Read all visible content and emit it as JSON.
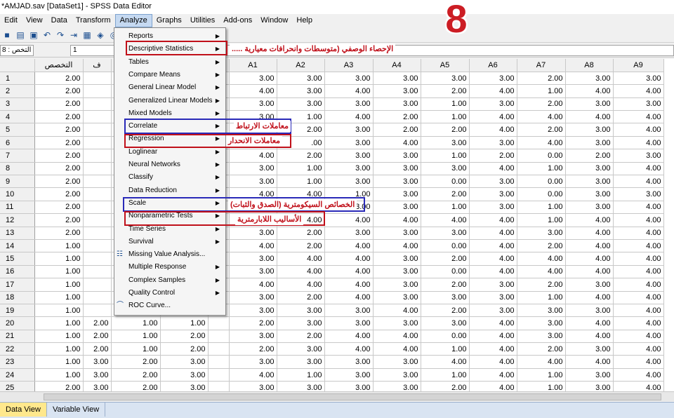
{
  "window": {
    "title": "*AMJAD.sav [DataSet1] - SPSS Data Editor"
  },
  "menubar": [
    "Edit",
    "View",
    "Data",
    "Transform",
    "Analyze",
    "Graphs",
    "Utilities",
    "Add-ons",
    "Window",
    "Help"
  ],
  "toolbar": {
    "icons": [
      "save-icon",
      "print-icon",
      "dialog-recall-icon",
      "undo-icon",
      "redo-icon",
      "goto-case-icon",
      "insert-variable-icon",
      "value-labels-icon",
      "use-sets-icon"
    ]
  },
  "cellbar": {
    "ref": "8 : التخص",
    "value": "1"
  },
  "grid": {
    "headers": [
      "",
      "التخصص",
      "ف",
      "",
      "",
      "",
      "A1",
      "A2",
      "A3",
      "A4",
      "A5",
      "A6",
      "A7",
      "A8",
      "A9"
    ],
    "rows": [
      [
        "1",
        "2.00",
        "",
        "",
        "",
        "",
        "3.00",
        "3.00",
        "3.00",
        "3.00",
        "3.00",
        "3.00",
        "2.00",
        "3.00",
        "3.00"
      ],
      [
        "2",
        "2.00",
        "",
        "",
        "",
        "",
        "4.00",
        "3.00",
        "4.00",
        "3.00",
        "2.00",
        "4.00",
        "1.00",
        "4.00",
        "4.00"
      ],
      [
        "3",
        "2.00",
        "",
        "",
        "",
        "",
        "3.00",
        "3.00",
        "3.00",
        "3.00",
        "1.00",
        "3.00",
        "2.00",
        "3.00",
        "3.00"
      ],
      [
        "4",
        "2.00",
        "",
        "",
        "",
        "",
        "3.00",
        "1.00",
        "4.00",
        "2.00",
        "1.00",
        "4.00",
        "4.00",
        "4.00",
        "4.00"
      ],
      [
        "5",
        "2.00",
        "",
        "",
        "",
        "",
        "3.00",
        "2.00",
        "3.00",
        "2.00",
        "2.00",
        "4.00",
        "2.00",
        "3.00",
        "4.00"
      ],
      [
        "6",
        "2.00",
        "",
        "",
        "",
        "",
        "4.00",
        ".00",
        "3.00",
        "4.00",
        "3.00",
        "3.00",
        "4.00",
        "3.00",
        "4.00"
      ],
      [
        "7",
        "2.00",
        "",
        "",
        "",
        "",
        "4.00",
        "2.00",
        "3.00",
        "3.00",
        "1.00",
        "2.00",
        "0.00",
        "2.00",
        "3.00"
      ],
      [
        "8",
        "2.00",
        "",
        "",
        "",
        "",
        "3.00",
        "1.00",
        "3.00",
        "3.00",
        "3.00",
        "4.00",
        "1.00",
        "3.00",
        "4.00"
      ],
      [
        "9",
        "2.00",
        "",
        "",
        "",
        "",
        "3.00",
        "1.00",
        "3.00",
        "3.00",
        "0.00",
        "3.00",
        "0.00",
        "3.00",
        "4.00"
      ],
      [
        "10",
        "2.00",
        "",
        "",
        "",
        "",
        "4.00",
        "4.00",
        "1.00",
        "3.00",
        "2.00",
        "3.00",
        "0.00",
        "3.00",
        "3.00"
      ],
      [
        "11",
        "2.00",
        "",
        "",
        "",
        "",
        "1.00",
        "1.00",
        "3.00",
        "3.00",
        "1.00",
        "3.00",
        "1.00",
        "3.00",
        "4.00"
      ],
      [
        "12",
        "2.00",
        "",
        "",
        "",
        "",
        "4.00",
        "4.00",
        "4.00",
        "4.00",
        "4.00",
        "4.00",
        "1.00",
        "4.00",
        "4.00"
      ],
      [
        "13",
        "2.00",
        "",
        "",
        "",
        "",
        "3.00",
        "2.00",
        "3.00",
        "3.00",
        "3.00",
        "4.00",
        "3.00",
        "4.00",
        "4.00"
      ],
      [
        "14",
        "1.00",
        "",
        "",
        "",
        "",
        "4.00",
        "2.00",
        "4.00",
        "4.00",
        "0.00",
        "4.00",
        "2.00",
        "4.00",
        "4.00"
      ],
      [
        "15",
        "1.00",
        "",
        "",
        "",
        "",
        "3.00",
        "4.00",
        "4.00",
        "3.00",
        "2.00",
        "4.00",
        "4.00",
        "4.00",
        "4.00"
      ],
      [
        "16",
        "1.00",
        "",
        "",
        "",
        "",
        "3.00",
        "4.00",
        "4.00",
        "3.00",
        "0.00",
        "4.00",
        "4.00",
        "4.00",
        "4.00"
      ],
      [
        "17",
        "1.00",
        "",
        "",
        "",
        "",
        "4.00",
        "4.00",
        "4.00",
        "3.00",
        "2.00",
        "3.00",
        "2.00",
        "3.00",
        "4.00"
      ],
      [
        "18",
        "1.00",
        "",
        "",
        "",
        "",
        "3.00",
        "2.00",
        "4.00",
        "3.00",
        "3.00",
        "3.00",
        "1.00",
        "4.00",
        "4.00"
      ],
      [
        "19",
        "1.00",
        "",
        "",
        "",
        "",
        "3.00",
        "3.00",
        "3.00",
        "4.00",
        "2.00",
        "3.00",
        "3.00",
        "3.00",
        "4.00"
      ],
      [
        "20",
        "1.00",
        "2.00",
        "1.00",
        "1.00",
        "",
        "2.00",
        "3.00",
        "3.00",
        "3.00",
        "3.00",
        "4.00",
        "3.00",
        "4.00",
        "4.00"
      ],
      [
        "21",
        "1.00",
        "2.00",
        "1.00",
        "2.00",
        "",
        "3.00",
        "2.00",
        "4.00",
        "4.00",
        "0.00",
        "4.00",
        "3.00",
        "4.00",
        "4.00"
      ],
      [
        "22",
        "1.00",
        "2.00",
        "1.00",
        "2.00",
        "",
        "2.00",
        "3.00",
        "4.00",
        "4.00",
        "1.00",
        "4.00",
        "2.00",
        "3.00",
        "4.00"
      ],
      [
        "23",
        "1.00",
        "3.00",
        "2.00",
        "3.00",
        "",
        "3.00",
        "3.00",
        "3.00",
        "3.00",
        "4.00",
        "4.00",
        "4.00",
        "4.00",
        "4.00"
      ],
      [
        "24",
        "1.00",
        "3.00",
        "2.00",
        "3.00",
        "",
        "4.00",
        "1.00",
        "3.00",
        "3.00",
        "1.00",
        "4.00",
        "1.00",
        "3.00",
        "4.00"
      ],
      [
        "25",
        "2.00",
        "3.00",
        "2.00",
        "3.00",
        "",
        "3.00",
        "3.00",
        "3.00",
        "3.00",
        "2.00",
        "4.00",
        "1.00",
        "3.00",
        "4.00"
      ]
    ]
  },
  "dropdown": {
    "items": [
      {
        "label": "Reports",
        "sub": true
      },
      {
        "label": "Descriptive Statistics",
        "sub": true
      },
      {
        "label": "Tables",
        "sub": true
      },
      {
        "label": "Compare Means",
        "sub": true
      },
      {
        "label": "General Linear Model",
        "sub": true
      },
      {
        "label": "Generalized Linear Models",
        "sub": true
      },
      {
        "label": "Mixed Models",
        "sub": true
      },
      {
        "label": "Correlate",
        "sub": true
      },
      {
        "label": "Regression",
        "sub": true
      },
      {
        "label": "Loglinear",
        "sub": true
      },
      {
        "label": "Neural Networks",
        "sub": true
      },
      {
        "label": "Classify",
        "sub": true
      },
      {
        "label": "Data Reduction",
        "sub": true
      },
      {
        "label": "Scale",
        "sub": true
      },
      {
        "label": "Nonparametric Tests",
        "sub": true
      },
      {
        "label": "Time Series",
        "sub": true
      },
      {
        "label": "Survival",
        "sub": true
      },
      {
        "label": "Missing Value Analysis...",
        "sub": false,
        "icon": "missing-value-icon"
      },
      {
        "label": "Multiple Response",
        "sub": true
      },
      {
        "label": "Complex Samples",
        "sub": true
      },
      {
        "label": "Quality Control",
        "sub": true
      },
      {
        "label": "ROC Curve...",
        "sub": false,
        "icon": "roc-curve-icon"
      }
    ]
  },
  "annotations": {
    "descriptive": "الإحصاء الوصفي (متوسطات وانحرافات معيارية .....",
    "correlate": "معاملات الارتباط",
    "regression": "معاملات الانحدار",
    "scale": "الخصائص السيكومترية (الصدق والثبات)",
    "nonparametric": "الأساليب اللابارمترية",
    "number": "8"
  },
  "tabs": [
    "Data View",
    "Variable View"
  ],
  "colors": {
    "accent": "#c0101a",
    "blue_box": "#2a2ab8",
    "menu_highlight": "#c5d9f1",
    "tab_active": "#ffe88c"
  }
}
